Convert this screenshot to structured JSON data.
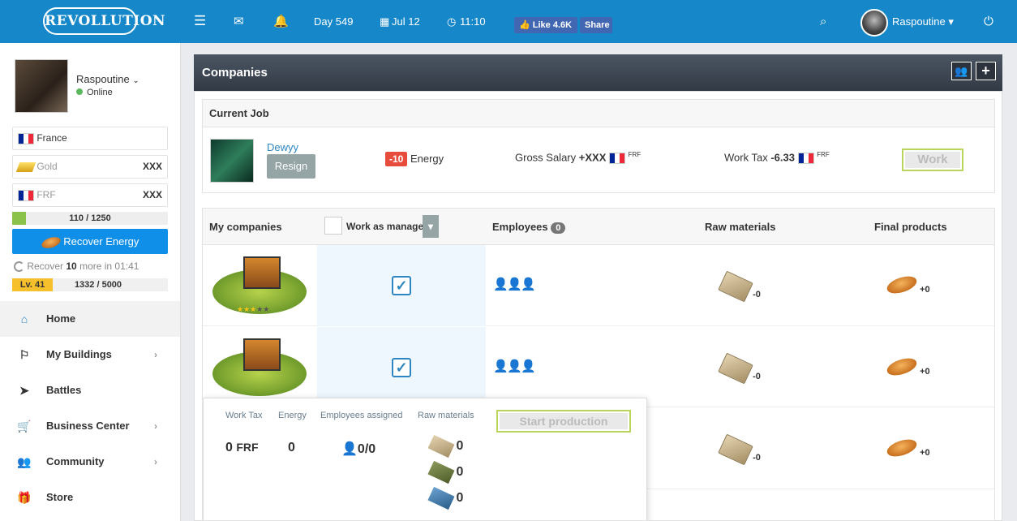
{
  "topbar": {
    "logo": "REVOLLUTION",
    "day": "Day 549",
    "date": "Jul 12",
    "time": "11:10",
    "like_label": "Like",
    "like_count": "4.6K",
    "share_label": "Share",
    "username": "Raspoutine"
  },
  "sidebar": {
    "username": "Raspoutine",
    "status": "Online",
    "country": "France",
    "gold_label": "Gold",
    "gold_value": "XXX",
    "currency_label": "FRF",
    "currency_value": "XXX",
    "energy": "110 / 1250",
    "recover_label": "Recover Energy",
    "recover_text_pre": "Recover ",
    "recover_amount": "10",
    "recover_text_post": " more in 01:41",
    "level": "Lv. 41",
    "xp": "1332 / 5000",
    "nav": [
      {
        "label": "Home",
        "icon": "home-icon"
      },
      {
        "label": "My Buildings",
        "icon": "flag-icon"
      },
      {
        "label": "Battles",
        "icon": "paper-plane-icon"
      },
      {
        "label": "Business Center",
        "icon": "cart-icon"
      },
      {
        "label": "Community",
        "icon": "users-icon"
      },
      {
        "label": "Store",
        "icon": "gift-icon"
      }
    ]
  },
  "panel": {
    "title": "Companies"
  },
  "current_job": {
    "header": "Current Job",
    "employer": "Dewyy",
    "resign_label": "Resign",
    "energy_cost": "-10",
    "energy_label": "Energy",
    "salary_label": "Gross Salary",
    "salary_value": "+XXX",
    "salary_currency": "FRF",
    "tax_label": "Work Tax",
    "tax_value": "-6.33",
    "tax_currency": "FRF",
    "work_label": "Work"
  },
  "companies": {
    "header_name": "My companies",
    "manager_label": "Work as manager",
    "employees_label": "Employees",
    "employees_count": "0",
    "raw_label": "Raw materials",
    "final_label": "Final products",
    "rows": [
      {
        "raw": "-0",
        "final": "+0"
      },
      {
        "raw": "-0",
        "final": "+0"
      },
      {
        "raw": "-0",
        "final": "+0"
      }
    ]
  },
  "production": {
    "tax_label": "Work Tax",
    "energy_label": "Energy",
    "assigned_label": "Employees assigned",
    "raw_label": "Raw materials",
    "start_label": "Start production",
    "tax_value": "0",
    "tax_currency": "FRF",
    "energy_value": "0",
    "assigned_value": "0/0",
    "raw_values": [
      "0",
      "0",
      "0"
    ]
  },
  "colors": {
    "topbar": "#1687c9",
    "recover_button": "#0f8fe8",
    "level_badge": "#f6c02c",
    "energy_bar": "#8bc34a",
    "badge_red": "#e74c3c"
  }
}
